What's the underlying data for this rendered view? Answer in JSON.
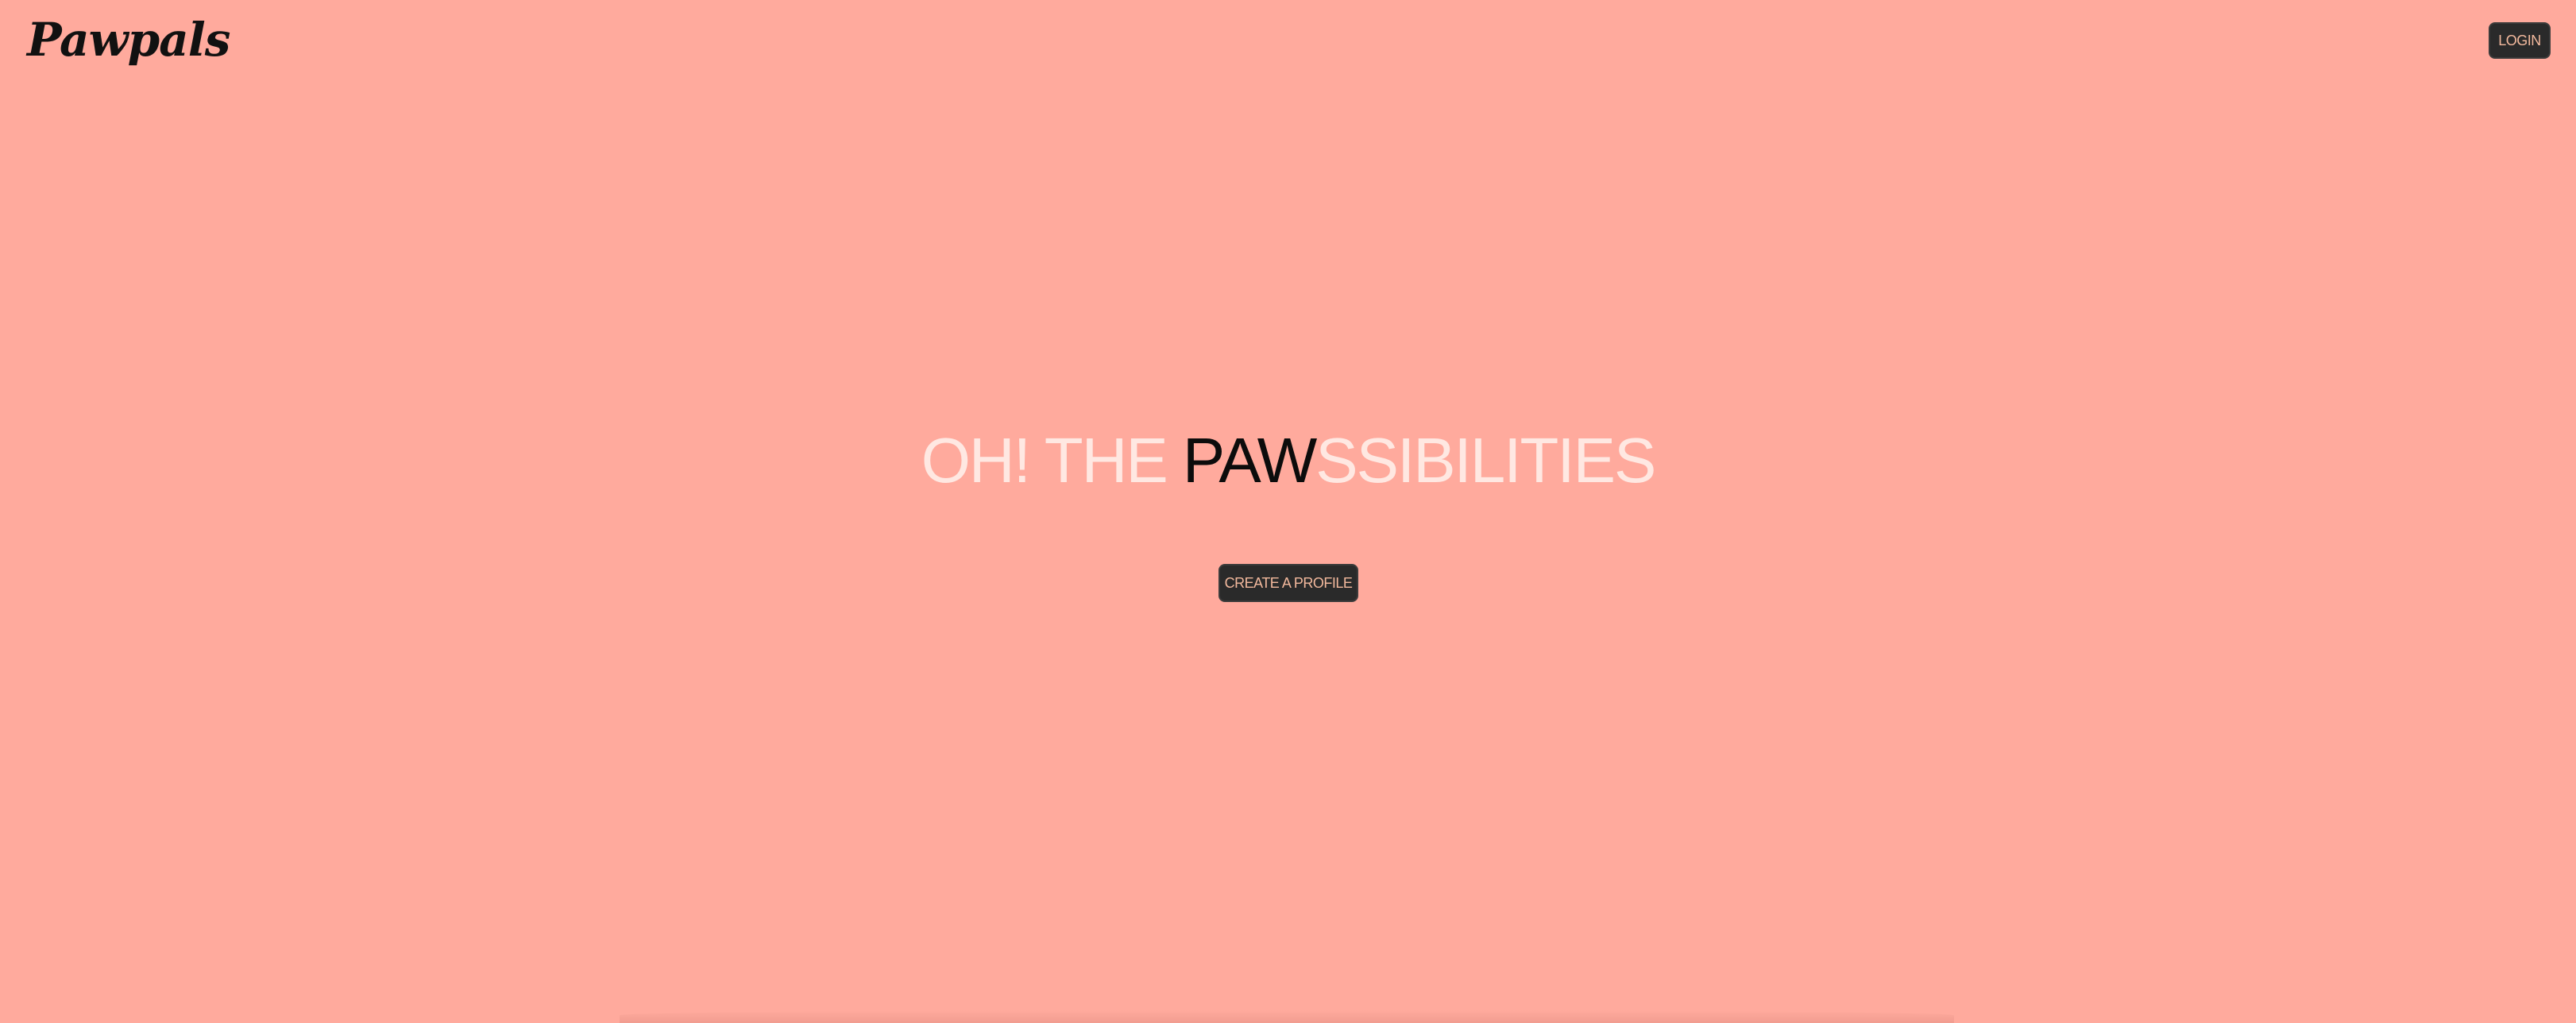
{
  "header": {
    "logo_text": "Pawpals",
    "login_label": "LOGIN"
  },
  "hero": {
    "title_part1": "OH! THE ",
    "title_highlight": "PAW",
    "title_part2": "SSIBILITIES",
    "cta_label": "CREATE A PROFILE"
  },
  "colors": {
    "background": "#FFAA9D",
    "button_bg": "#2A2A2A",
    "button_text": "#F3B99D",
    "hero_light_text": "#FFE8E2",
    "hero_dark_text": "#0C0C0C"
  }
}
